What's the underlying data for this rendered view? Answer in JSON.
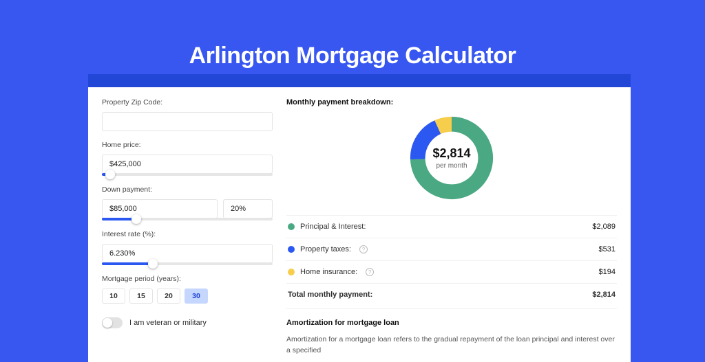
{
  "title": "Arlington Mortgage Calculator",
  "form": {
    "zip_label": "Property Zip Code:",
    "zip_value": "",
    "price_label": "Home price:",
    "price_value": "$425,000",
    "price_pct": 5,
    "down_label": "Down payment:",
    "down_amount": "$85,000",
    "down_pct_value": "20%",
    "down_slider_pct": 20,
    "rate_label": "Interest rate (%):",
    "rate_value": "6.230%",
    "rate_slider_pct": 30,
    "period_label": "Mortgage period (years):",
    "period_options": [
      "10",
      "15",
      "20",
      "30"
    ],
    "period_selected": "30",
    "veteran_label": "I am veteran or military"
  },
  "breakdown": {
    "title": "Monthly payment breakdown:",
    "total_amount": "$2,814",
    "total_sub": "per month",
    "items": [
      {
        "label": "Principal & Interest:",
        "value": "$2,089",
        "color": "#4aa883",
        "pct": 74.3,
        "info": false
      },
      {
        "label": "Property taxes:",
        "value": "$531",
        "color": "#2a58f0",
        "pct": 18.8,
        "info": true
      },
      {
        "label": "Home insurance:",
        "value": "$194",
        "color": "#f7cd4c",
        "pct": 6.9,
        "info": true
      }
    ],
    "total_label": "Total monthly payment:",
    "total_value": "$2,814"
  },
  "amort": {
    "title": "Amortization for mortgage loan",
    "text": "Amortization for a mortgage loan refers to the gradual repayment of the loan principal and interest over a specified"
  },
  "chart_data": {
    "type": "pie",
    "title": "Monthly payment breakdown",
    "series": [
      {
        "name": "Principal & Interest",
        "value": 2089,
        "color": "#4aa883"
      },
      {
        "name": "Property taxes",
        "value": 531,
        "color": "#2a58f0"
      },
      {
        "name": "Home insurance",
        "value": 194,
        "color": "#f7cd4c"
      }
    ],
    "center_label": "$2,814 per month",
    "total": 2814
  }
}
